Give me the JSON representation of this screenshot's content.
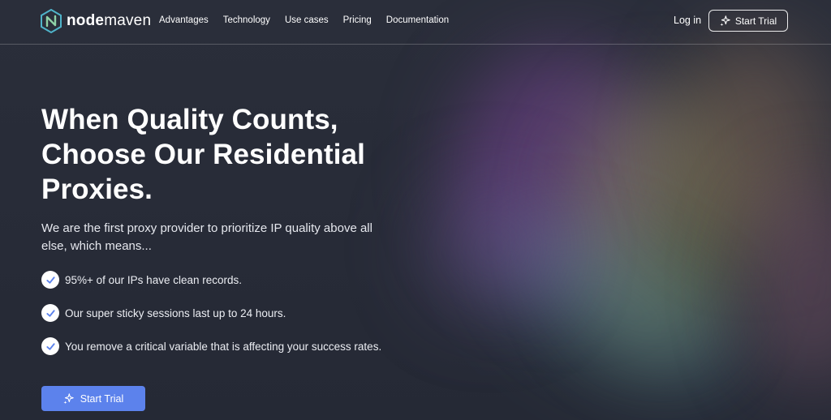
{
  "brand": {
    "name_bold": "node",
    "name_rest": "maven"
  },
  "nav": {
    "menu": [
      "Advantages",
      "Technology",
      "Use cases",
      "Pricing",
      "Documentation"
    ],
    "login_label": "Log in",
    "cta_label": "Start Trial"
  },
  "hero": {
    "title_lines": [
      "When Quality Counts,",
      "Choose Our Residential",
      "Proxies."
    ],
    "subtitle": "We are the first proxy provider to prioritize IP quality above all else, which means...",
    "features": [
      "95%+ of our IPs have clean records.",
      "Our super sticky sessions last up to 24 hours.",
      "You remove a critical variable that is affecting your success rates."
    ],
    "cta_label": "Start Trial"
  },
  "colors": {
    "background": "#262a36",
    "accent_button": "#5c82ec",
    "check_mark": "#5c82ec",
    "logo_teal": "#4fb3c9"
  },
  "icons": [
    "logo-icon",
    "sparkle-icon",
    "check-circle-icon"
  ]
}
